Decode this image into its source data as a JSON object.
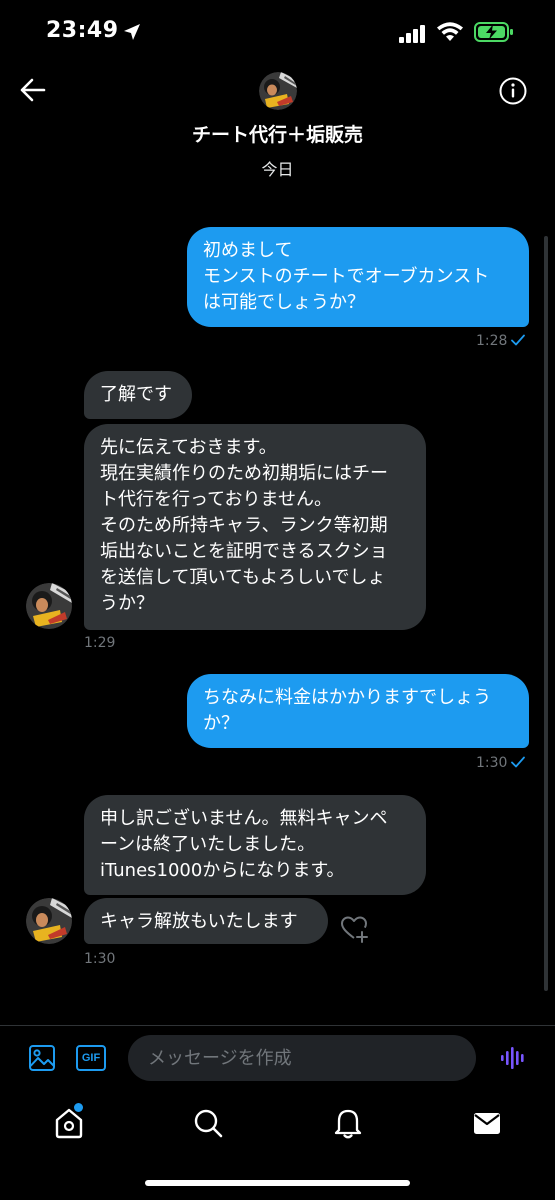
{
  "status_bar": {
    "time": "23:49"
  },
  "header": {
    "contact_name": "チート代行＋垢販売",
    "date_label": "今日"
  },
  "messages": [
    {
      "direction": "sent",
      "text": "初めまして\nモンストのチートでオーブカンスト\nは可能でしょうか？",
      "time": "1:28"
    },
    {
      "direction": "received",
      "text": "了解です"
    },
    {
      "direction": "received",
      "text": "先に伝えておきます。\n現在実績作りのため初期垢にはチー\nト代行を行っておりません。\nそのため所持キャラ、ランク等初期\n垢出ないことを証明できるスクショ\nを送信して頂いてもよろしいでしょ\nうか？",
      "time": "1:29"
    },
    {
      "direction": "sent",
      "text": "ちなみに料金はかかりますでしょう\nか？",
      "time": "1:30"
    },
    {
      "direction": "received",
      "text": "申し訳ございません。無料キャンペ\nーンは終了いたしました。\niTunes1000からになります。"
    },
    {
      "direction": "received",
      "text": "キャラ解放もいたします",
      "time": "1:30"
    }
  ],
  "compose": {
    "placeholder": "メッセージを作成"
  },
  "buttons": {
    "gif_label": "GIF"
  },
  "colors": {
    "sent_bubble": "#1d9bf0",
    "received_bubble": "#2f3336",
    "background": "#000000",
    "accent_voice": "#7856ff"
  }
}
